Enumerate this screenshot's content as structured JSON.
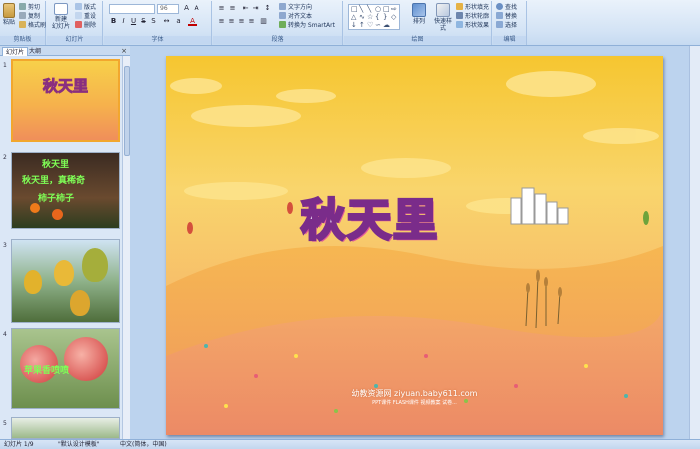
{
  "ribbon": {
    "clipboard": {
      "paste": "粘贴",
      "cut": "剪切",
      "copy": "复制",
      "format_painter": "格式刷",
      "label": "剪贴板"
    },
    "slides": {
      "new_slide": "新建",
      "new_slide_line2": "幻灯片",
      "layout": "版式",
      "reset": "重设",
      "delete": "删除",
      "label": "幻灯片"
    },
    "font": {
      "font_size": "96",
      "label": "字体"
    },
    "paragraph": {
      "text_direction": "文字方向",
      "align_text": "对齐文本",
      "smartart": "转换为 SmartArt",
      "label": "段落"
    },
    "drawing": {
      "arrange": "排列",
      "quick_styles": "快速样式",
      "shape_fill": "形状填充",
      "shape_outline": "形状轮廓",
      "shape_effects": "形状效果",
      "label": "绘图"
    },
    "editing": {
      "find": "查找",
      "replace": "替换",
      "select": "选择",
      "label": "编辑"
    }
  },
  "leftpane": {
    "tabs": [
      "幻灯片",
      "大纲"
    ],
    "close": "×",
    "slides": [
      {
        "num": "1",
        "title": "秋天里"
      },
      {
        "num": "2",
        "lines": [
          "秋天里",
          "秋天里，真稀奇",
          "柿子柿子"
        ]
      },
      {
        "num": "3"
      },
      {
        "num": "4",
        "caption": "苹果香喷喷"
      },
      {
        "num": "5"
      }
    ]
  },
  "slide": {
    "title": "秋天里",
    "watermark_line1": "幼教资源网 ziyuan.baby611.com",
    "watermark_line2": "PPT课件  FLASH课件  视频教案  试卷..."
  },
  "statusbar": {
    "slide_info": "幻灯片 1/9",
    "theme": "\"默认设计模板\"",
    "language": "中文(简体，中国)"
  }
}
